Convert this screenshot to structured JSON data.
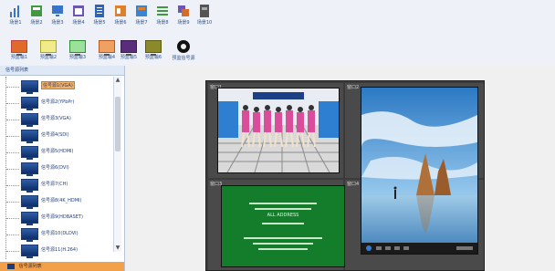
{
  "toolbar_row1": [
    {
      "label": "场景1",
      "icon": "bar-chart-icon",
      "color": "#3a74c8"
    },
    {
      "label": "场景2",
      "icon": "green-square-icon",
      "color": "#3f9a3f"
    },
    {
      "label": "场景3",
      "icon": "monitor-icon",
      "color": "#3a74c8"
    },
    {
      "label": "场景4",
      "icon": "purple-window-icon",
      "color": "#6d55b5"
    },
    {
      "label": "场景5",
      "icon": "blue-document-icon",
      "color": "#2f63b5"
    },
    {
      "label": "场景6",
      "icon": "orange-window-icon",
      "color": "#e07f2a"
    },
    {
      "label": "场景7",
      "icon": "blue-window-icon",
      "color": "#3b84d2"
    },
    {
      "label": "场景8",
      "icon": "list-icon",
      "color": "#3f9a3f"
    },
    {
      "label": "场景9",
      "icon": "multi-window-icon",
      "color": "#d36b2a"
    },
    {
      "label": "场景10",
      "icon": "gray-document-icon",
      "color": "#555555"
    }
  ],
  "toolbar_row2": [
    {
      "label": "预监输1",
      "color": "#e06a2a"
    },
    {
      "label": "预监输2",
      "color": "#d8d23a"
    },
    {
      "label": "预监输3",
      "color": "#3fbf3f"
    },
    {
      "label": "预监输4",
      "color": "#e07f2a"
    },
    {
      "label": "预监输5",
      "color": "#5a2d7a"
    },
    {
      "label": "预监输6",
      "color": "#8a8a2a"
    },
    {
      "label": "预监信号源",
      "color": "#111111"
    }
  ],
  "sidebar": {
    "header": "信号源列表",
    "items": [
      "信号源1(VGA)",
      "信号源2(YPbPr)",
      "信号源3(VGA)",
      "信号源4(SDI)",
      "信号源5(HDMI)",
      "信号源6(DVI)",
      "信号源7(CH)",
      "信号源8(4K_HDMI)",
      "信号源9(HDBASET)",
      "信号源10(DLDVI)",
      "信号源11(H.264)"
    ],
    "footer": "信号源列表"
  },
  "wall": {
    "cell_tags": [
      "窗口1",
      "窗口2",
      "窗口3",
      "窗口4"
    ],
    "video_text": [
      "ALL ADDRESS"
    ]
  }
}
